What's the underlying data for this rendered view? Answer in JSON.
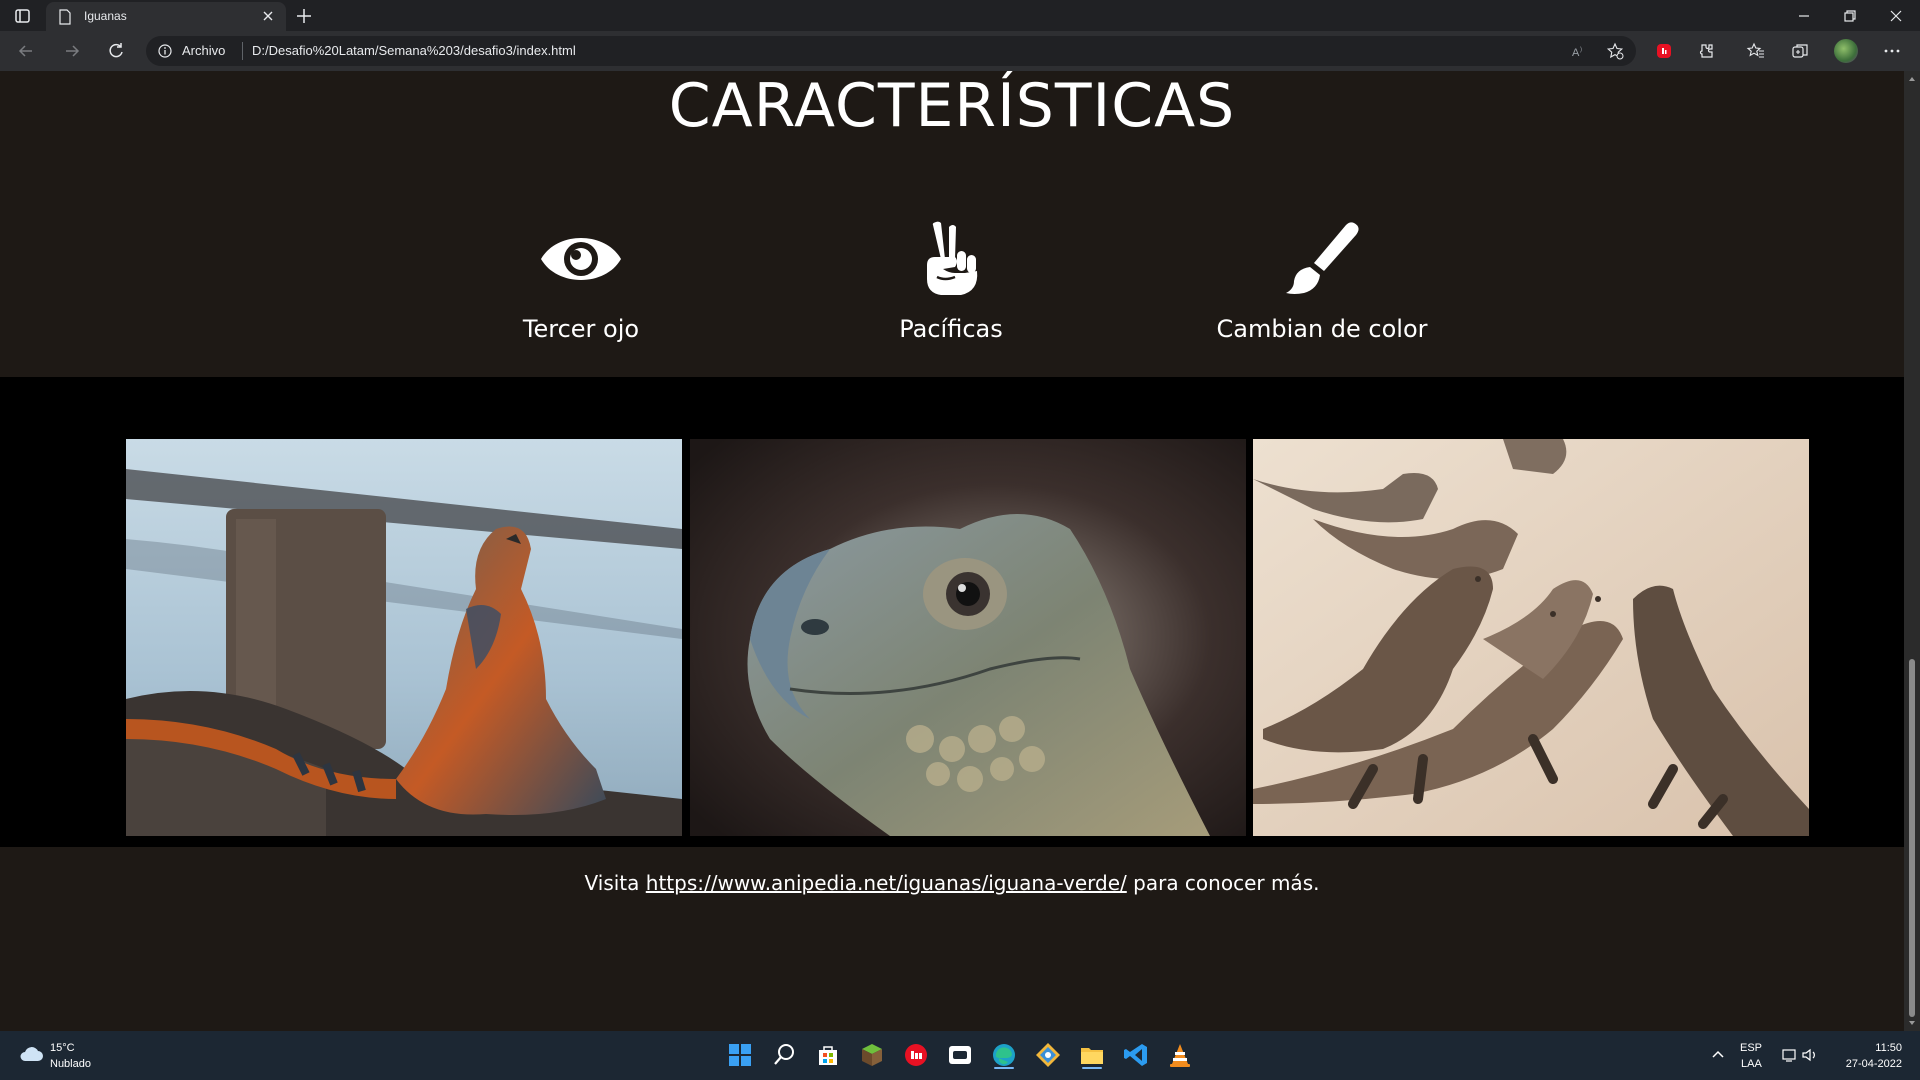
{
  "browser": {
    "tab_title": "Iguanas",
    "security_label": "Archivo",
    "url": "D:/Desafio%20Latam/Semana%203/desafio3/index.html"
  },
  "page": {
    "heading": "CARACTERÍSTICAS",
    "features": [
      {
        "label": "Tercer ojo",
        "icon": "eye-icon"
      },
      {
        "label": "Pacíficas",
        "icon": "peace-hand-icon"
      },
      {
        "label": "Cambian de color",
        "icon": "paint-brush-icon"
      }
    ],
    "gallery": [
      {
        "name": "iguana-by-sea-photo"
      },
      {
        "name": "iguana-closeup-photo"
      },
      {
        "name": "iguanas-on-sand-photo"
      }
    ],
    "footer": {
      "prefix": "Visita",
      "link": "https://www.anipedia.net/iguanas/iguana-verde/",
      "suffix": "para conocer más."
    }
  },
  "taskbar": {
    "weather_temp": "15°C",
    "weather_desc": "Nublado",
    "lang_top": "ESP",
    "lang_bottom": "LAA",
    "time": "11:50",
    "date": "27-04-2022"
  },
  "colors": {
    "section_bg": "#1e1915",
    "gallery_bg": "#000000",
    "taskbar_bg": "#1c2733"
  }
}
